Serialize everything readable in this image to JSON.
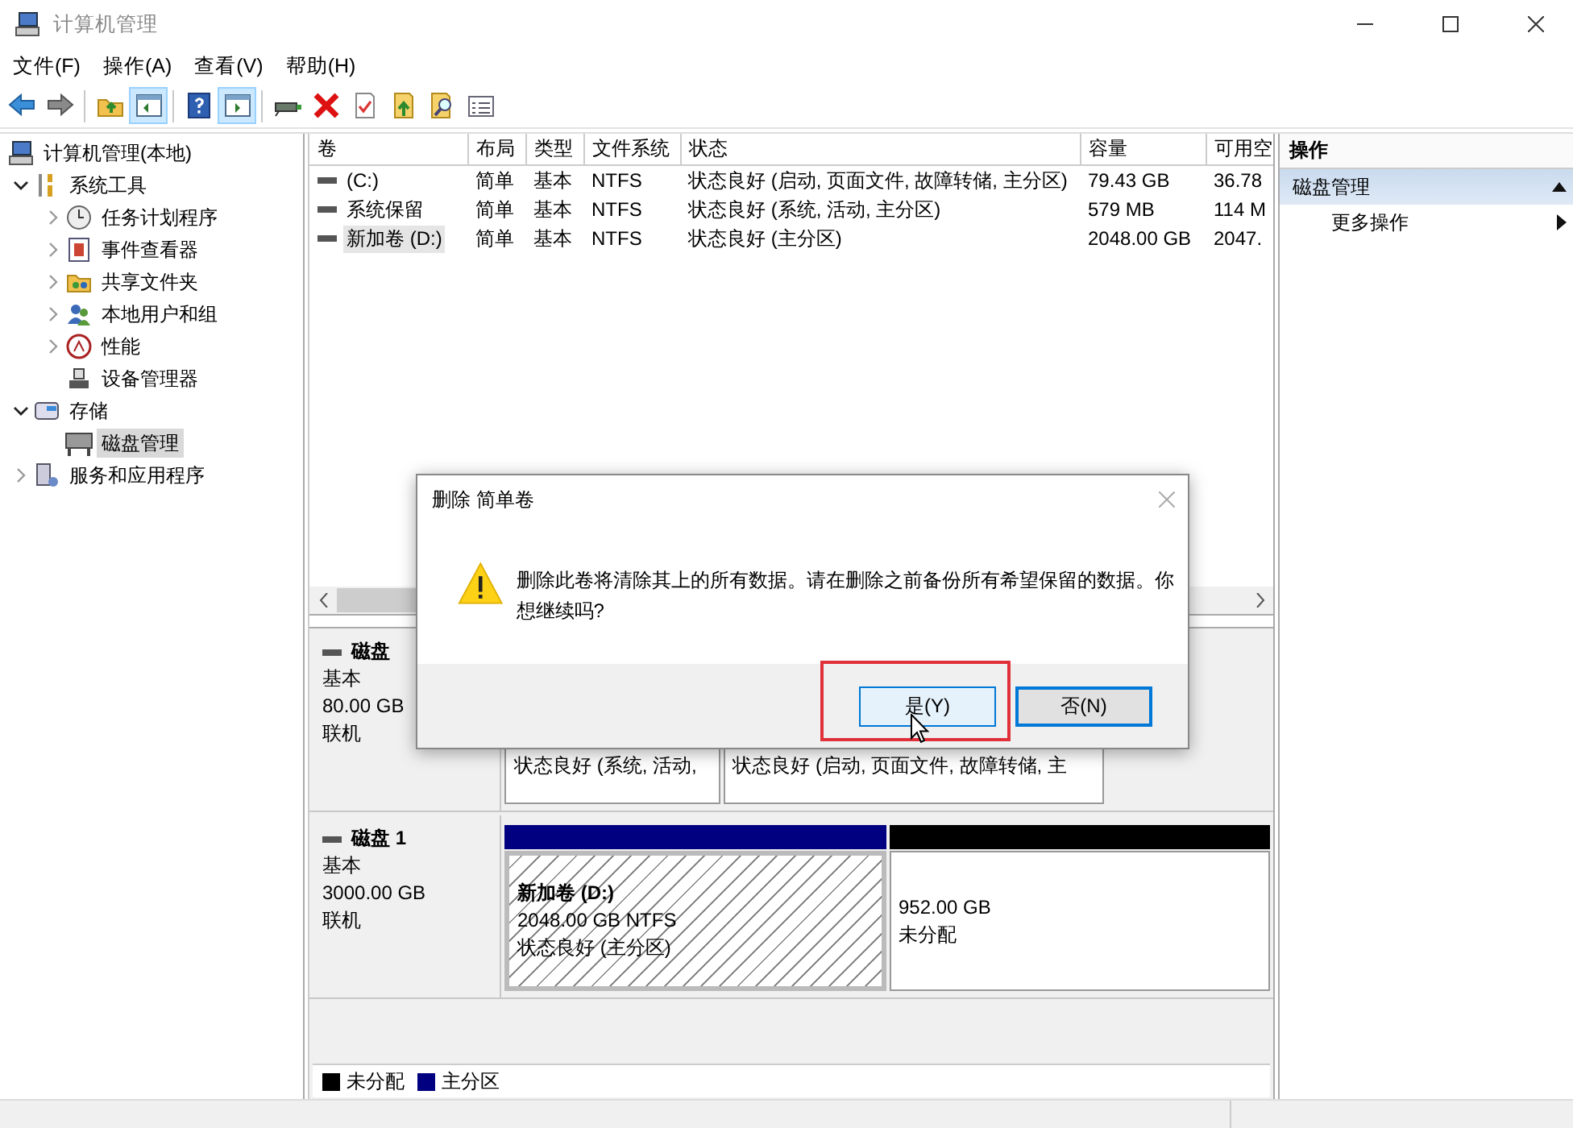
{
  "window": {
    "title": "计算机管理"
  },
  "menu": [
    "文件(F)",
    "操作(A)",
    "查看(V)",
    "帮助(H)"
  ],
  "toolbar_groups": [
    {
      "buttons": [
        {
          "kind": "back",
          "pressed": false
        },
        {
          "kind": "forward",
          "pressed": false
        }
      ]
    },
    {
      "buttons": [
        {
          "kind": "up-folder",
          "pressed": false
        },
        {
          "kind": "pane-left",
          "pressed": true
        }
      ]
    },
    {
      "buttons": [
        {
          "kind": "help",
          "pressed": false
        },
        {
          "kind": "pane-right",
          "pressed": true
        }
      ]
    },
    {
      "buttons": [
        {
          "kind": "drive",
          "pressed": false
        },
        {
          "kind": "delete",
          "pressed": false
        },
        {
          "kind": "properties",
          "pressed": false
        },
        {
          "kind": "export",
          "pressed": false
        },
        {
          "kind": "search",
          "pressed": false
        },
        {
          "kind": "list",
          "pressed": false
        }
      ]
    }
  ],
  "tree": [
    {
      "label": "计算机管理(本地)",
      "kind": "computer",
      "selected": false,
      "children": [
        {
          "label": "系统工具",
          "kind": "tools",
          "expandable": true,
          "expanded": true,
          "selected": false,
          "children": [
            {
              "label": "任务计划程序",
              "kind": "clock",
              "expandable": true,
              "expanded": false,
              "selected": false
            },
            {
              "label": "事件查看器",
              "kind": "event",
              "expandable": true,
              "expanded": false,
              "selected": false
            },
            {
              "label": "共享文件夹",
              "kind": "share",
              "expandable": true,
              "expanded": false,
              "selected": false
            },
            {
              "label": "本地用户和组",
              "kind": "users",
              "expandable": true,
              "expanded": false,
              "selected": false
            },
            {
              "label": "性能",
              "kind": "performance",
              "expandable": true,
              "expanded": false,
              "selected": false
            },
            {
              "label": "设备管理器",
              "kind": "device",
              "selected": false
            }
          ]
        },
        {
          "label": "存储",
          "kind": "storage",
          "expandable": true,
          "expanded": true,
          "selected": false,
          "children": [
            {
              "label": "磁盘管理",
              "kind": "disk",
              "selected": true
            }
          ]
        },
        {
          "label": "服务和应用程序",
          "kind": "services",
          "expandable": true,
          "expanded": false,
          "selected": false
        }
      ]
    }
  ],
  "table": {
    "columns": [
      "卷",
      "布局",
      "类型",
      "文件系统",
      "状态",
      "容量",
      "可用空"
    ],
    "rows": [
      {
        "selected": false,
        "cells": [
          "(C:)",
          "简单",
          "基本",
          "NTFS",
          "状态良好 (启动, 页面文件, 故障转储, 主分区)",
          "79.43 GB",
          "36.78"
        ]
      },
      {
        "selected": false,
        "cells": [
          "系统保留",
          "简单",
          "基本",
          "NTFS",
          "状态良好 (系统, 活动, 主分区)",
          "579 MB",
          "114 M"
        ]
      },
      {
        "selected": true,
        "cells": [
          "新加卷 (D:)",
          "简单",
          "基本",
          "NTFS",
          "状态良好 (主分区)",
          "2048.00 GB",
          "2047."
        ]
      }
    ]
  },
  "disks": [
    {
      "name": "磁盘",
      "type": "基本",
      "size": "80.00 GB",
      "status": "联机",
      "partitions": [
        {
          "selected": false,
          "lines": [
            "状态良好 (系统, 活动,"
          ]
        },
        {
          "selected": false,
          "lines": [
            "状态良好 (启动, 页面文件, 故障转储, 主"
          ]
        }
      ]
    },
    {
      "name": "磁盘 1",
      "type": "基本",
      "size": "3000.00 GB",
      "status": "联机",
      "partitions": [
        {
          "kind": "primary",
          "selected": true,
          "label": "新加卷  (D:)",
          "lines": [
            "2048.00 GB NTFS",
            "状态良好 (主分区)"
          ]
        },
        {
          "kind": "unallocated",
          "selected": false,
          "lines": [
            "952.00 GB",
            "未分配"
          ]
        }
      ]
    }
  ],
  "legend": [
    {
      "label": "未分配",
      "color": "#000000"
    },
    {
      "label": "主分区",
      "color": "#000080"
    }
  ],
  "actions": {
    "title": "操作",
    "sections": [
      {
        "title": "磁盘管理",
        "expanded": true,
        "items": [
          "更多操作"
        ]
      }
    ]
  },
  "dialog": {
    "title": "删除 简单卷",
    "message": "删除此卷将清除其上的所有数据。请在删除之前备份所有希望保留的数据。你想继续吗?",
    "buttons": [
      {
        "label": "是(Y)",
        "hovered": true,
        "default": false,
        "highlighted": true
      },
      {
        "label": "否(N)",
        "hovered": false,
        "default": true,
        "highlighted": false
      }
    ]
  }
}
